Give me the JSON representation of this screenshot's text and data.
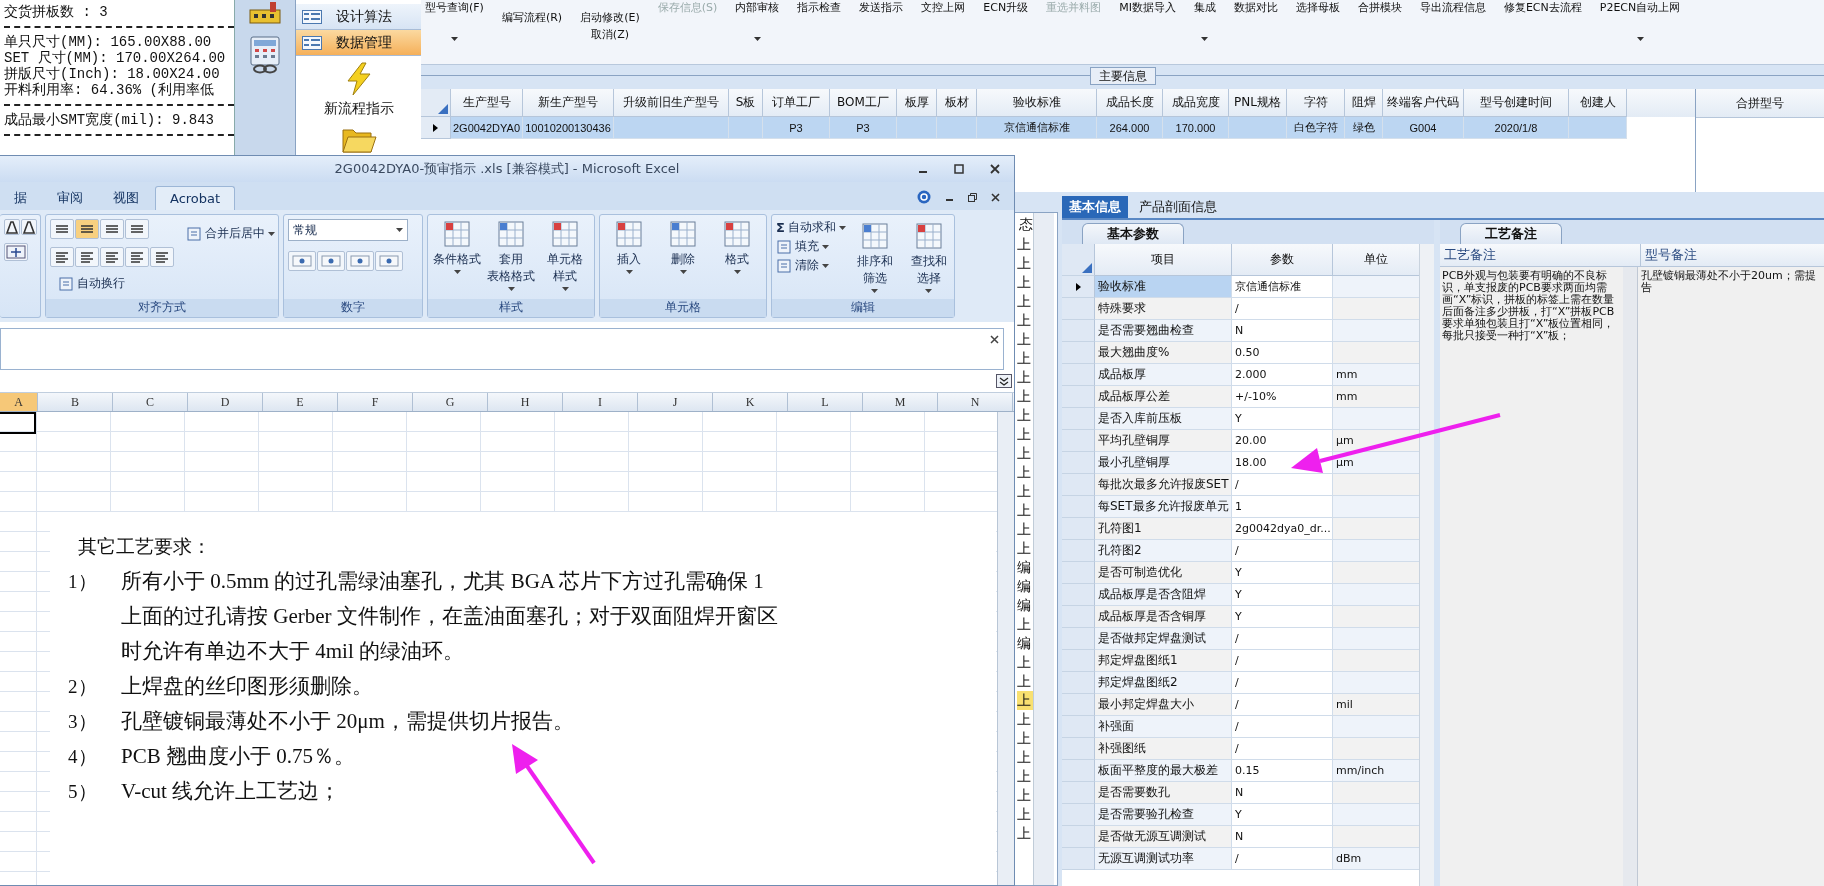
{
  "info_panel": {
    "lines": [
      {
        "kind": "text",
        "text": "交货拼板数 : 3"
      },
      {
        "kind": "rule"
      },
      {
        "kind": "text",
        "text": "单只尺寸(MM): 165.00X88.00"
      },
      {
        "kind": "text",
        "text": "SET 尺寸(MM): 170.00X264.00"
      },
      {
        "kind": "text",
        "text": "拼版尺寸(Inch): 18.00X24.00"
      },
      {
        "kind": "text",
        "text": "开料利用率: 64.36% (利用率低"
      },
      {
        "kind": "rule"
      },
      {
        "kind": "text",
        "text": "成品最小SMT宽度(mil): 9.843"
      },
      {
        "kind": "rule"
      }
    ]
  },
  "nav": {
    "items": [
      {
        "label": "设计算法",
        "selected": false
      },
      {
        "label": "数据管理",
        "selected": true
      }
    ],
    "actions": [
      {
        "kind": "lightning",
        "label": "新流程指示"
      },
      {
        "kind": "folder"
      }
    ]
  },
  "toolbar": {
    "items": [
      {
        "label": "型号查询(F)",
        "kind": "top",
        "caret": true,
        "disabled": false
      },
      {
        "label": "编写流程(R)",
        "kind": "low",
        "caret": false,
        "disabled": false
      },
      {
        "label": "启动修改(E)",
        "sublabel": "取消(Z)",
        "kind": "low",
        "caret": false,
        "disabled": false
      },
      {
        "label": "保存信息(S)",
        "kind": "top",
        "caret": false,
        "disabled": true
      },
      {
        "label": "内部审核",
        "kind": "top",
        "caret": true,
        "disabled": false
      },
      {
        "label": "指示检查",
        "kind": "top",
        "caret": false,
        "disabled": false
      },
      {
        "label": "发送指示",
        "kind": "top",
        "caret": false,
        "disabled": false
      },
      {
        "label": "文控上网",
        "kind": "top",
        "caret": false,
        "disabled": false
      },
      {
        "label": "ECN升级",
        "kind": "top",
        "caret": false,
        "disabled": false
      },
      {
        "label": "重选并料图",
        "kind": "top",
        "caret": false,
        "disabled": true
      },
      {
        "label": "MI数据导入",
        "kind": "top",
        "caret": false,
        "disabled": false
      },
      {
        "label": "集成",
        "kind": "top",
        "caret": true,
        "disabled": false
      },
      {
        "label": "数据对比",
        "kind": "top",
        "caret": false,
        "disabled": false
      },
      {
        "label": "选择母板",
        "kind": "top",
        "caret": false,
        "disabled": false
      },
      {
        "label": "合拼模块",
        "kind": "top",
        "caret": false,
        "disabled": false
      },
      {
        "label": "导出流程信息",
        "kind": "top",
        "caret": false,
        "disabled": false
      },
      {
        "label": "修复ECN去流程",
        "kind": "top",
        "caret": false,
        "disabled": false
      },
      {
        "label": "P2ECN自动上网",
        "kind": "top",
        "caret": true,
        "disabled": false
      }
    ]
  },
  "main_info": {
    "title": "主要信息",
    "columns": [
      "生产型号",
      "新生产型号",
      "升级前旧生产型号",
      "S板",
      "订单工厂",
      "BOM工厂",
      "板厚",
      "板材",
      "验收标准",
      "成品长度",
      "成品宽度",
      "PNL规格",
      "字符",
      "阻焊",
      "终端客户代码",
      "型号创建时间",
      "创建人"
    ],
    "rows": [
      {
        "selected": true,
        "cells": [
          "2G0042DYA0",
          "10010200130436",
          null,
          null,
          "P3",
          "P3",
          null,
          null,
          "京信通信标准",
          "264.000",
          "170.000",
          null,
          "白色字符",
          "绿色",
          "G004",
          "2020/1/8",
          null
        ]
      }
    ],
    "side_column": "合拼型号"
  },
  "status_list": {
    "header": "态",
    "items": [
      {
        "text": "上",
        "selected": false
      },
      {
        "text": "上",
        "selected": false
      },
      {
        "text": "上",
        "selected": false
      },
      {
        "text": "上",
        "selected": false
      },
      {
        "text": "上",
        "selected": false
      },
      {
        "text": "上",
        "selected": false
      },
      {
        "text": "上",
        "selected": false
      },
      {
        "text": "上",
        "selected": false
      },
      {
        "text": "上",
        "selected": false
      },
      {
        "text": "上",
        "selected": false
      },
      {
        "text": "上",
        "selected": false
      },
      {
        "text": "上",
        "selected": false
      },
      {
        "text": "上",
        "selected": false
      },
      {
        "text": "上",
        "selected": false
      },
      {
        "text": "上",
        "selected": false
      },
      {
        "text": "上",
        "selected": false
      },
      {
        "text": "上",
        "selected": false
      },
      {
        "text": "编",
        "selected": false
      },
      {
        "text": "编",
        "selected": false
      },
      {
        "text": "编",
        "selected": false
      },
      {
        "text": "上",
        "selected": false
      },
      {
        "text": "编",
        "selected": false
      },
      {
        "text": "上",
        "selected": false
      },
      {
        "text": "上",
        "selected": false
      },
      {
        "text": "上",
        "selected": true
      },
      {
        "text": "上",
        "selected": false
      },
      {
        "text": "上",
        "selected": false
      },
      {
        "text": "上",
        "selected": false
      },
      {
        "text": "上",
        "selected": false
      },
      {
        "text": "上",
        "selected": false
      },
      {
        "text": "上",
        "selected": false
      },
      {
        "text": "上",
        "selected": false
      }
    ]
  },
  "detail": {
    "tabs": [
      {
        "label": "基本信息",
        "selected": true
      },
      {
        "label": "产品剖面信息",
        "selected": false
      }
    ],
    "params": {
      "tab": "基本参数",
      "columns": [
        "项目",
        "参数",
        "单位"
      ],
      "rows": [
        {
          "item": "验收标准",
          "value": "京信通信标准",
          "selected": true
        },
        {
          "item": "特殊要求",
          "value": "/",
          "selected": false
        },
        {
          "item": "是否需要翘曲检查",
          "value": "N",
          "selected": false
        },
        {
          "item": "最大翘曲度%",
          "value": "0.50",
          "selected": false
        },
        {
          "item": "成品板厚",
          "value": "2.000",
          "unit": "mm",
          "selected": false
        },
        {
          "item": "成品板厚公差",
          "value": "+/-10%",
          "unit": "mm",
          "selected": false
        },
        {
          "item": "是否入库前压板",
          "value": "Y",
          "selected": false
        },
        {
          "item": "平均孔壁铜厚",
          "value": "20.00",
          "unit": "μm",
          "selected": false
        },
        {
          "item": "最小孔壁铜厚",
          "value": "18.00",
          "unit": "μm",
          "selected": false
        },
        {
          "item": "每批次最多允许报废SET",
          "value": "/",
          "selected": false
        },
        {
          "item": "每SET最多允许报废单元",
          "value": "1",
          "selected": false
        },
        {
          "item": "孔符图1",
          "value": "2g0042dya0_dr...",
          "selected": false
        },
        {
          "item": "孔符图2",
          "value": "/",
          "selected": false
        },
        {
          "item": "是否可制造优化",
          "value": "Y",
          "selected": false
        },
        {
          "item": "成品板厚是否含阻焊",
          "value": "Y",
          "selected": false
        },
        {
          "item": "成品板厚是否含铜厚",
          "value": "Y",
          "selected": false
        },
        {
          "item": "是否做邦定焊盘测试",
          "value": "/",
          "selected": false
        },
        {
          "item": "邦定焊盘图纸1",
          "value": "/",
          "selected": false
        },
        {
          "item": "邦定焊盘图纸2",
          "value": "/",
          "selected": false
        },
        {
          "item": "最小邦定焊盘大小",
          "value": "/",
          "unit": "mil",
          "selected": false
        },
        {
          "item": "补强面",
          "value": "/",
          "selected": false
        },
        {
          "item": "补强图纸",
          "value": "/",
          "selected": false
        },
        {
          "item": "板面平整度的最大极差",
          "value": "0.15",
          "unit": "mm/inch",
          "selected": false
        },
        {
          "item": "是否需要数孔",
          "value": "N",
          "selected": false
        },
        {
          "item": "是否需要验孔检查",
          "value": "Y",
          "selected": false
        },
        {
          "item": "是否做无源互调测试",
          "value": "N",
          "selected": false
        },
        {
          "item": "无源互调测试功率",
          "value": "/",
          "unit": "dBm",
          "selected": false
        }
      ]
    },
    "notes": {
      "tab": "工艺备注",
      "columns": [
        "工艺备注",
        "型号备注"
      ],
      "process_note": "PCB外观与包装要有明确的不良标识，单支报废的PCB要求两面均需画“X”标识，拼板的标签上需在数量后面备注多少拼板，打“X”拼板PCB要求单独包装且打“X”板位置相同，每批只接受一种打“X”板；",
      "model_note_lines": [
        "孔壁镀铜最薄处不小于20um；需提",
        "告"
      ]
    }
  },
  "excel": {
    "title": "2G0042DYA0-预审指示 .xls  [兼容模式] - Microsoft Excel",
    "tabs": [
      {
        "label": "据",
        "selected": false
      },
      {
        "label": "审阅",
        "selected": false
      },
      {
        "label": "视图",
        "selected": false
      },
      {
        "label": "Acrobat",
        "selected": true
      }
    ],
    "groups": [
      {
        "kind": "font"
      },
      {
        "kind": "align",
        "label": "对齐方式",
        "buttons": [
          {
            "kind": "small",
            "lines": [
              "自动换行"
            ],
            "caret": false
          },
          {
            "kind": "small",
            "lines": [
              "合并后居中"
            ],
            "caret": true
          }
        ]
      },
      {
        "kind": "number",
        "label": "数字",
        "buttons": [
          {
            "kind": "dropdown",
            "lines": [
              "常规"
            ],
            "caret": true
          }
        ]
      },
      {
        "kind": "plain",
        "label": "样式",
        "buttons": [
          {
            "kind": "large",
            "lines": [
              "条件格式"
            ],
            "caret": true
          },
          {
            "kind": "large",
            "lines": [
              "套用",
              "表格格式"
            ],
            "caret": true
          },
          {
            "kind": "large",
            "lines": [
              "单元格",
              "样式"
            ],
            "caret": true
          }
        ]
      },
      {
        "kind": "plain",
        "label": "单元格",
        "buttons": [
          {
            "kind": "large",
            "lines": [
              "插入"
            ],
            "caret": true
          },
          {
            "kind": "large",
            "lines": [
              "删除"
            ],
            "caret": true
          },
          {
            "kind": "large",
            "lines": [
              "格式"
            ],
            "caret": true
          }
        ]
      },
      {
        "kind": "edit",
        "label": "编辑",
        "buttons": [
          {
            "kind": "small",
            "symbol": "Σ",
            "lines": [
              "自动求和"
            ],
            "caret": true
          },
          {
            "kind": "small",
            "lines": [
              "填充"
            ],
            "caret": true
          },
          {
            "kind": "small",
            "lines": [
              "清除"
            ],
            "caret": true
          },
          {
            "kind": "large",
            "lines": [
              "排序和",
              "筛选"
            ],
            "caret": true
          },
          {
            "kind": "large",
            "lines": [
              "查找和",
              "选择"
            ],
            "caret": true
          }
        ]
      }
    ],
    "columns": [
      {
        "label": "A",
        "selected": true
      },
      {
        "label": "B",
        "selected": false
      },
      {
        "label": "C",
        "selected": false
      },
      {
        "label": "D",
        "selected": false
      },
      {
        "label": "E",
        "selected": false
      },
      {
        "label": "F",
        "selected": false
      },
      {
        "label": "G",
        "selected": false
      },
      {
        "label": "H",
        "selected": false
      },
      {
        "label": "I",
        "selected": false
      },
      {
        "label": "J",
        "selected": false
      },
      {
        "label": "K",
        "selected": false
      },
      {
        "label": "L",
        "selected": false
      },
      {
        "label": "M",
        "selected": false
      },
      {
        "label": "N",
        "selected": false
      }
    ],
    "sheet_text": {
      "heading": "其它工艺要求：",
      "items": [
        {
          "number": "1）",
          "lines": [
            "所有小于 0.5mm 的过孔需绿油塞孔，尤其 BGA 芯片下方过孔需确保 1",
            "上面的过孔请按 Gerber 文件制作，在盖油面塞孔；对于双面阻焊开窗区",
            "时允许有单边不大于 4mil 的绿油环。"
          ]
        },
        {
          "number": "2）",
          "lines": [
            "上焊盘的丝印图形须删除。"
          ]
        },
        {
          "number": "3）",
          "lines": [
            "孔壁镀铜最薄处不小于 20μm，需提供切片报告。"
          ]
        },
        {
          "number": "4）",
          "lines": [
            "PCB 翘曲度小于 0.75％。"
          ]
        },
        {
          "number": "5）",
          "lines": [
            "V-cut 线允许上工艺边；"
          ]
        }
      ]
    }
  }
}
